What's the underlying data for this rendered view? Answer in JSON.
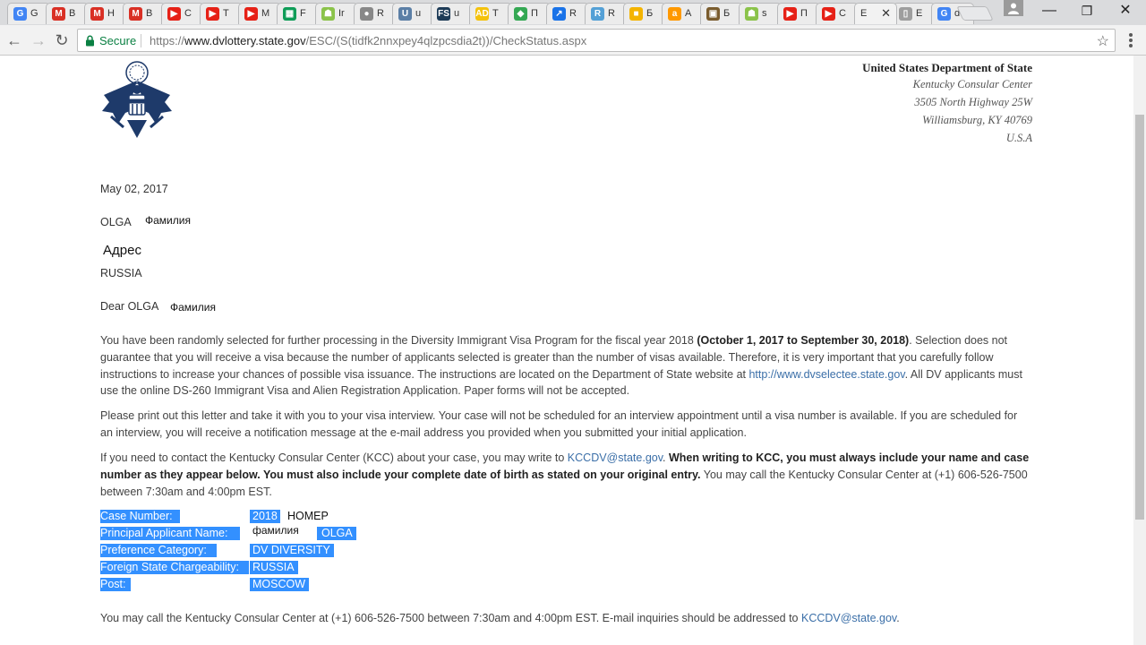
{
  "tabs": [
    {
      "fav": "G",
      "color": "#4285f4",
      "title": "G"
    },
    {
      "fav": "M",
      "color": "#d93025",
      "title": "B"
    },
    {
      "fav": "M",
      "color": "#d93025",
      "title": "H"
    },
    {
      "fav": "M",
      "color": "#d93025",
      "title": "B"
    },
    {
      "fav": "▶",
      "color": "#e62117",
      "title": "C"
    },
    {
      "fav": "▶",
      "color": "#e62117",
      "title": "T"
    },
    {
      "fav": "▶",
      "color": "#e62117",
      "title": "M"
    },
    {
      "fav": "▦",
      "color": "#0f9d58",
      "title": "F"
    },
    {
      "fav": "☗",
      "color": "#8bc34a",
      "title": "Ir"
    },
    {
      "fav": "●",
      "color": "#888888",
      "title": "R"
    },
    {
      "fav": "U",
      "color": "#5b7fa6",
      "title": "u"
    },
    {
      "fav": "FS",
      "color": "#1d3b57",
      "title": "u"
    },
    {
      "fav": "AD",
      "color": "#f4c20d",
      "title": "T"
    },
    {
      "fav": "◆",
      "color": "#34a853",
      "title": "П"
    },
    {
      "fav": "↗",
      "color": "#1a73e8",
      "title": "R"
    },
    {
      "fav": "R",
      "color": "#54a0d6",
      "title": "R"
    },
    {
      "fav": "■",
      "color": "#f4b400",
      "title": "Б"
    },
    {
      "fav": "a",
      "color": "#ff9900",
      "title": "A"
    },
    {
      "fav": "▣",
      "color": "#7a5c2e",
      "title": "Б"
    },
    {
      "fav": "☗",
      "color": "#8bc34a",
      "title": "s"
    },
    {
      "fav": "▶",
      "color": "#e62117",
      "title": "П"
    },
    {
      "fav": "▶",
      "color": "#e62117",
      "title": "C"
    },
    {
      "fav": "",
      "color": "#ffffff",
      "title": "E",
      "active": true
    },
    {
      "fav": "▯",
      "color": "#9e9e9e",
      "title": "E"
    },
    {
      "fav": "G",
      "color": "#4285f4",
      "title": "d"
    }
  ],
  "active_tab_close": "✕",
  "window": {
    "minimize": "—",
    "restore": "❐",
    "close": "✕"
  },
  "nav": {
    "back": "←",
    "forward": "→",
    "reload": "↻"
  },
  "omnibox": {
    "secure_label": "Secure",
    "url_scheme": "https://",
    "url_host": "www.dvlottery.state.gov",
    "url_path": "/ESC/(S(tidfk2nnxpey4qlzpcsdia2t))/CheckStatus.aspx",
    "star": "☆"
  },
  "letterhead": {
    "department": "United States Department of State",
    "lines": [
      "Kentucky Consular Center",
      "3505 North Highway 25W",
      "Williamsburg, KY 40769",
      "U.S.A"
    ]
  },
  "letter": {
    "date": "May 02, 2017",
    "first_name": "OLGA",
    "surname_hw": "Фамилия",
    "address_hw": "Адрес",
    "country": "RUSSIA",
    "greeting": "Dear OLGA",
    "greeting_surname_hw": "Фамилия",
    "p1_a": "You have been randomly selected for further processing in the Diversity Immigrant Visa Program for the fiscal year 2018 ",
    "p1_b": "(October 1, 2017 to September 30, 2018)",
    "p1_c": ". Selection does not guarantee that you will receive a visa because the number of applicants selected is greater than the number of visas available. Therefore, it is very important that you carefully follow instructions to increase your chances of possible visa issuance. The instructions are located on the Department of State website at ",
    "p1_link": "http://www.dvselectee.state.gov",
    "p1_d": ". All DV applicants must use the online DS-260 Immigrant Visa and Alien Registration Application. Paper forms will not be accepted.",
    "p2": "Please print out this letter and take it with you to your visa interview. Your case will not be scheduled for an interview appointment until a visa number is available. If you are scheduled for an interview, you will receive a notification message at the e-mail address you provided when you submitted your initial application.",
    "p3_a": "If you need to contact the Kentucky Consular Center (KCC) about your case, you may write to ",
    "p3_link": "KCCDV@state.gov",
    "p3_b": ". ",
    "p3_bold": "When writing to KCC, you must always include your name and case number as they appear below. You must also include your complete date of birth as stated on your original entry.",
    "p3_c": " You may call the Kentucky Consular Center at (+1) 606-526-7500 between 7:30am and 4:00pm EST.",
    "case": {
      "case_label": "Case Number:",
      "case_value": "2018",
      "case_hw": "НОМЕР",
      "name_label": "Principal Applicant Name:",
      "name_hw": "фамилия",
      "name_value": "OLGA",
      "pref_label": "Preference Category:",
      "pref_value": "DV DIVERSITY",
      "charge_label": "Foreign State Chargeability:",
      "charge_value": "RUSSIA",
      "post_label": "Post:",
      "post_value": "MOSCOW"
    },
    "p4_a": "You may call the Kentucky Consular Center at (+1) 606-526-7500 between 7:30am and 4:00pm EST. E-mail inquiries should be addressed to ",
    "p4_link": "KCCDV@state.gov",
    "p4_b": "."
  }
}
